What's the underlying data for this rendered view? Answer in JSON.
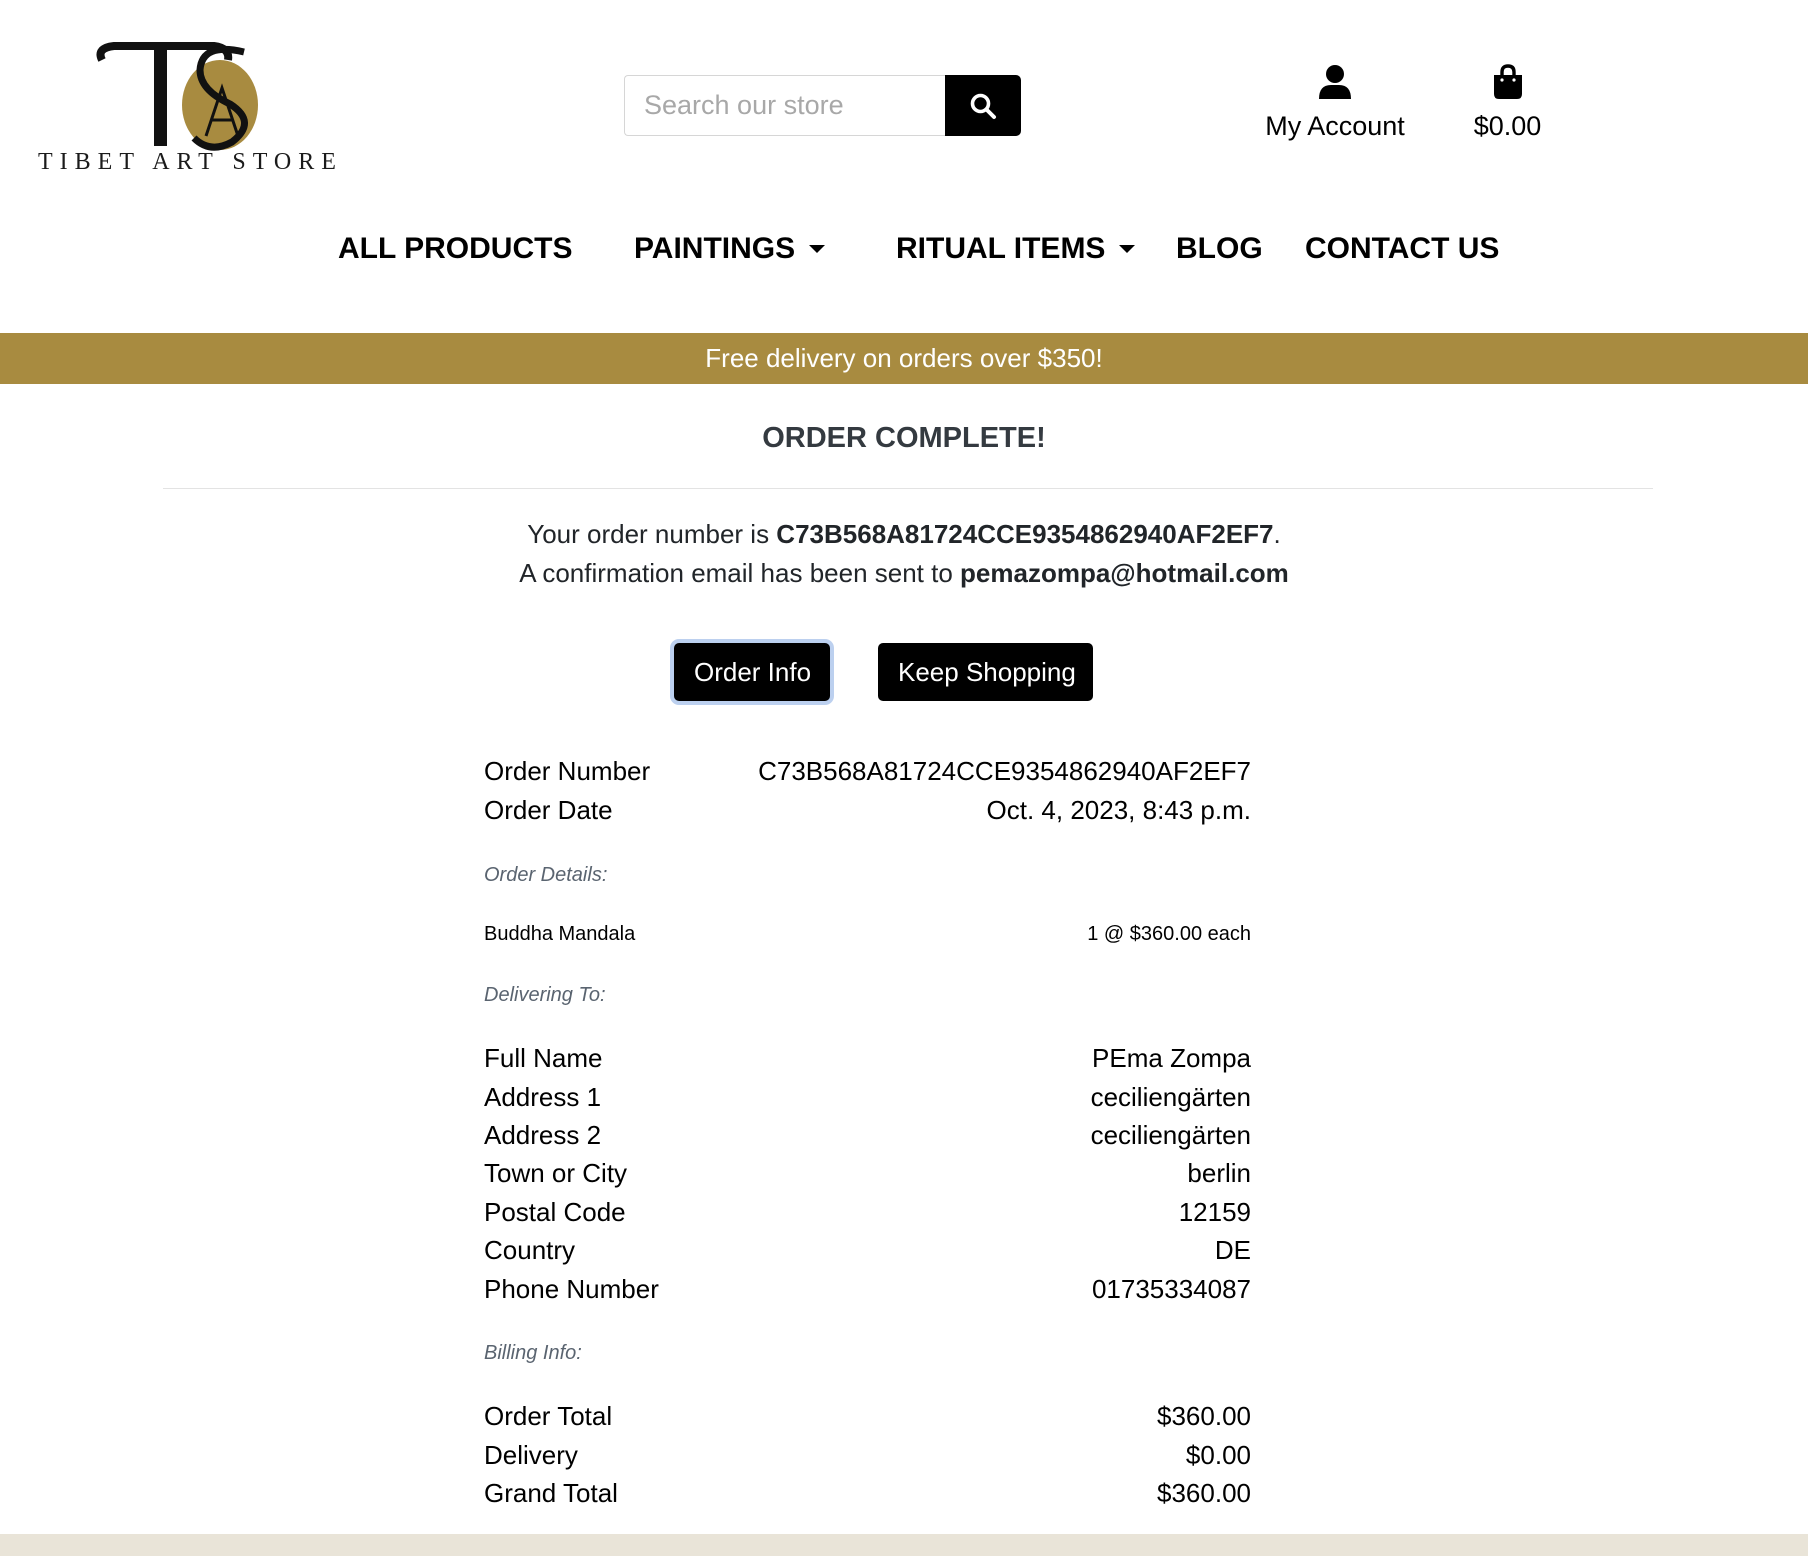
{
  "brand": {
    "logo_text": "TIBET ART STORE",
    "accent_color": "#a88b40"
  },
  "header": {
    "search_placeholder": "Search our store",
    "account_label": "My Account",
    "cart_total": "$0.00"
  },
  "nav": {
    "items": [
      {
        "label": "ALL PRODUCTS",
        "dropdown": false
      },
      {
        "label": "PAINTINGS",
        "dropdown": true
      },
      {
        "label": "RITUAL ITEMS",
        "dropdown": true
      },
      {
        "label": "BLOG",
        "dropdown": false
      },
      {
        "label": "CONTACT US",
        "dropdown": false
      }
    ]
  },
  "banner": {
    "text": "Free delivery on orders over $350!"
  },
  "main": {
    "title": "ORDER COMPLETE!",
    "message": {
      "order_prefix": "Your order number is ",
      "order_number": "C73B568A81724CCE9354862940AF2EF7",
      "order_suffix": ".",
      "email_prefix": "A confirmation email has been sent to ",
      "email": "pemazompa@hotmail.com"
    },
    "buttons": {
      "order_info": "Order Info",
      "keep_shopping": "Keep Shopping"
    },
    "order": {
      "number_label": "Order Number",
      "number_value": "C73B568A81724CCE9354862940AF2EF7",
      "date_label": "Order Date",
      "date_value": "Oct. 4, 2023, 8:43 p.m."
    },
    "details": {
      "heading": "Order Details:",
      "item_name": "Buddha Mandala",
      "item_qty_price": "1 @ $360.00 each"
    },
    "delivery": {
      "heading": "Delivering To:",
      "rows": [
        {
          "label": "Full Name",
          "value": "PEma Zompa"
        },
        {
          "label": "Address 1",
          "value": "ceciliengärten"
        },
        {
          "label": "Address 2",
          "value": "ceciliengärten"
        },
        {
          "label": "Town or City",
          "value": "berlin"
        },
        {
          "label": "Postal Code",
          "value": "12159"
        },
        {
          "label": "Country",
          "value": "DE"
        },
        {
          "label": "Phone Number",
          "value": "01735334087"
        }
      ]
    },
    "billing": {
      "heading": "Billing Info:",
      "rows": [
        {
          "label": "Order Total",
          "value": "$360.00"
        },
        {
          "label": "Delivery",
          "value": "$0.00"
        },
        {
          "label": "Grand Total",
          "value": "$360.00"
        }
      ]
    }
  }
}
